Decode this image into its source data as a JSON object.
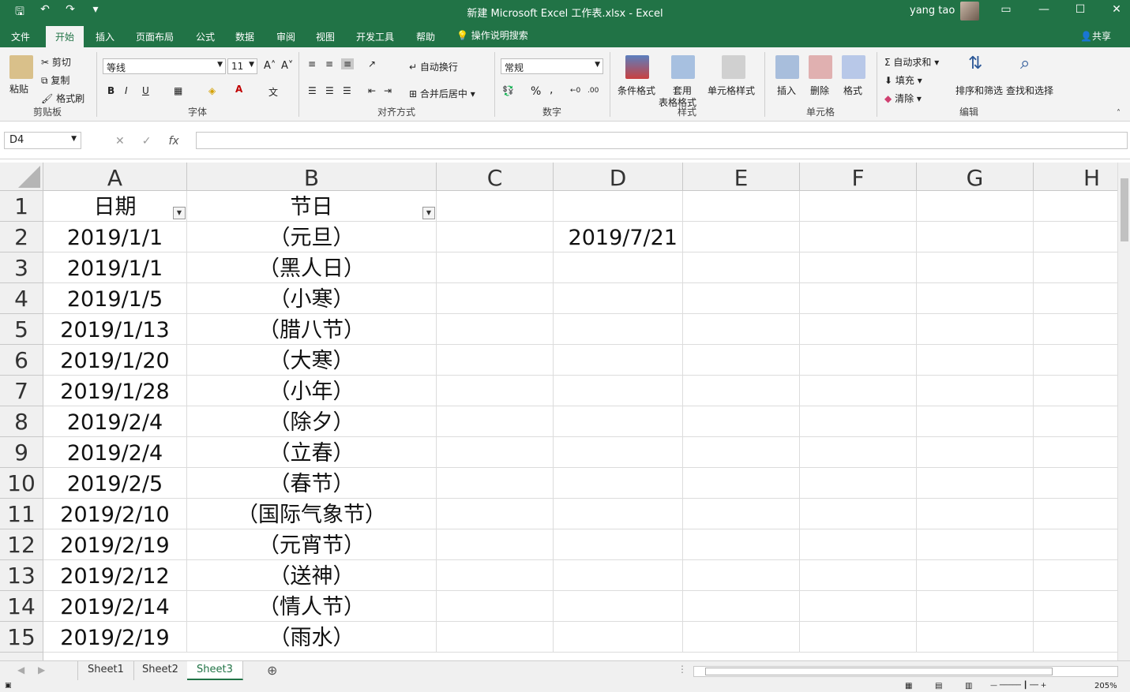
{
  "window": {
    "title": "新建 Microsoft Excel 工作表.xlsx  -  Excel",
    "user": "yang tao"
  },
  "menu": {
    "tabs": [
      "文件",
      "开始",
      "插入",
      "页面布局",
      "公式",
      "数据",
      "审阅",
      "视图",
      "开发工具",
      "帮助"
    ],
    "active": "开始",
    "tell_me": "操作说明搜索",
    "share": "共享"
  },
  "ribbon": {
    "clipboard": {
      "paste": "粘贴",
      "cut": "剪切",
      "copy": "复制",
      "painter": "格式刷",
      "label": "剪贴板"
    },
    "font": {
      "name": "等线",
      "size": "11",
      "label": "字体",
      "bold": "B",
      "italic": "I",
      "underline": "U"
    },
    "align": {
      "wrap": "自动换行",
      "merge": "合并后居中",
      "label": "对齐方式"
    },
    "number": {
      "format": "常规",
      "percent": "%",
      "comma": ",",
      "label": "数字"
    },
    "styles": {
      "cond": "条件格式",
      "table_a": "套用",
      "table_b": "表格格式",
      "cell": "单元格样式",
      "label": "样式"
    },
    "cells": {
      "insert": "插入",
      "delete": "删除",
      "format": "格式",
      "label": "单元格"
    },
    "editing": {
      "autosum": "自动求和",
      "fill": "填充",
      "clear": "清除",
      "sort": "排序和筛选",
      "find": "查找和选择",
      "label": "编辑"
    }
  },
  "formula_bar": {
    "name_box": "D4",
    "fx": "fx",
    "content": ""
  },
  "columns": [
    "A",
    "B",
    "C",
    "D",
    "E",
    "F",
    "G",
    "H"
  ],
  "rows": [
    {
      "n": "1",
      "a": "日期",
      "b": "节日",
      "d": ""
    },
    {
      "n": "2",
      "a": "2019/1/1",
      "b": "（元旦）",
      "d": "2019/7/21"
    },
    {
      "n": "3",
      "a": "2019/1/1",
      "b": "（黑人日）",
      "d": ""
    },
    {
      "n": "4",
      "a": "2019/1/5",
      "b": "（小寒）",
      "d": ""
    },
    {
      "n": "5",
      "a": "2019/1/13",
      "b": "（腊八节）",
      "d": ""
    },
    {
      "n": "6",
      "a": "2019/1/20",
      "b": "（大寒）",
      "d": ""
    },
    {
      "n": "7",
      "a": "2019/1/28",
      "b": "（小年）",
      "d": ""
    },
    {
      "n": "8",
      "a": "2019/2/4",
      "b": "（除夕）",
      "d": ""
    },
    {
      "n": "9",
      "a": "2019/2/4",
      "b": "（立春）",
      "d": ""
    },
    {
      "n": "10",
      "a": "2019/2/5",
      "b": "（春节）",
      "d": ""
    },
    {
      "n": "11",
      "a": "2019/2/10",
      "b": "（国际气象节）",
      "d": ""
    },
    {
      "n": "12",
      "a": "2019/2/19",
      "b": "（元宵节）",
      "d": ""
    },
    {
      "n": "13",
      "a": "2019/2/12",
      "b": "（送神）",
      "d": ""
    },
    {
      "n": "14",
      "a": "2019/2/14",
      "b": "（情人节）",
      "d": ""
    },
    {
      "n": "15",
      "a": "2019/2/19",
      "b": "（雨水）",
      "d": ""
    }
  ],
  "sheets": [
    "Sheet1",
    "Sheet2",
    "Sheet3"
  ],
  "active_sheet": "Sheet3",
  "status": {
    "zoom": "205%"
  },
  "colors": {
    "accent": "#217346"
  }
}
